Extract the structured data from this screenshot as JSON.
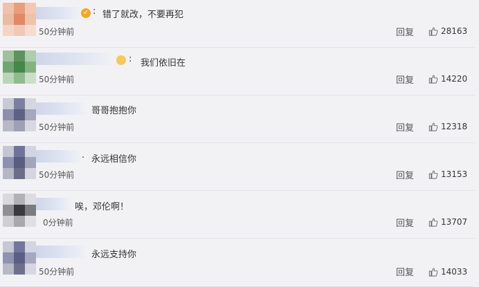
{
  "comments": [
    {
      "text": "错了就改，不要再犯",
      "time": "50分钟前",
      "reply_label": "回复",
      "likes": "28163"
    },
    {
      "text": "我们依旧在",
      "time": "50分钟前",
      "reply_label": "回复",
      "likes": "14220"
    },
    {
      "text": "哥哥抱抱你",
      "time": "50分钟前",
      "reply_label": "回复",
      "likes": "12318"
    },
    {
      "text": "永远相信你",
      "time": "50分钟前",
      "reply_label": "回复",
      "likes": "13153"
    },
    {
      "text": "唉，邓伦啊！",
      "time": "0分钟前",
      "reply_label": "回复",
      "likes": "13707"
    },
    {
      "text": "永远支持你",
      "time": "50分钟前",
      "reply_label": "回复",
      "likes": "14033"
    }
  ],
  "colors": {
    "background": "#f2f2f5",
    "divider": "#e3e3e8",
    "vip_badge": "#f5a623"
  },
  "icons": {
    "like": "thumbs-up-icon",
    "vip": "vip-badge-icon"
  }
}
